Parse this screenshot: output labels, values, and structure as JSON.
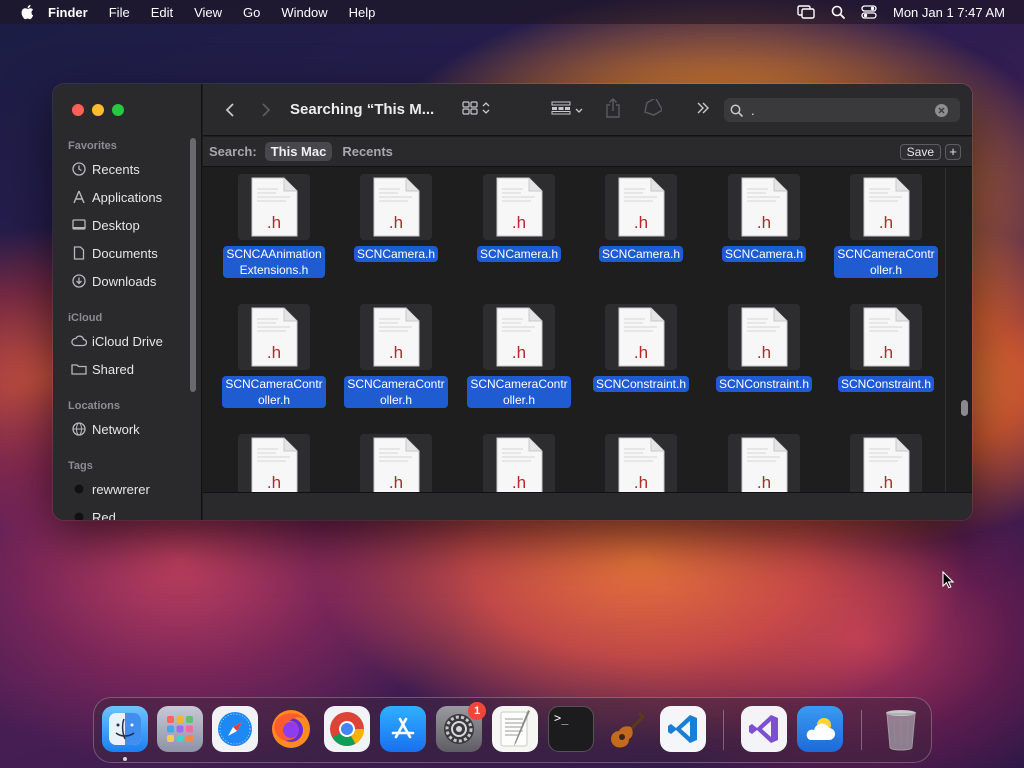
{
  "menubar": {
    "app_name": "Finder",
    "menus": [
      "File",
      "Edit",
      "View",
      "Go",
      "Window",
      "Help"
    ],
    "clock": "Mon Jan 1  7:47 AM"
  },
  "window": {
    "title": "Searching “This M...",
    "search": {
      "value": "."
    },
    "scope": {
      "label": "Search:",
      "options": [
        "This Mac",
        "Recents"
      ],
      "active": "This Mac",
      "save_label": "Save",
      "add_label": "+"
    }
  },
  "sidebar": {
    "favorites_label": "Favorites",
    "favorites": [
      "Recents",
      "Applications",
      "Desktop",
      "Documents",
      "Downloads"
    ],
    "icloud_label": "iCloud",
    "icloud": [
      "iCloud Drive",
      "Shared"
    ],
    "locations_label": "Locations",
    "locations": [
      "Network"
    ],
    "tags_label": "Tags",
    "tags": [
      {
        "label": "rewwrerer",
        "color": "#1c1c1e"
      },
      {
        "label": "Red",
        "color": "#1c1c1e"
      }
    ]
  },
  "files": [
    {
      "name": "SCNCAAnimation Extensions.h",
      "ext": ".h"
    },
    {
      "name": "SCNCamera.h",
      "ext": ".h"
    },
    {
      "name": "SCNCamera.h",
      "ext": ".h"
    },
    {
      "name": "SCNCamera.h",
      "ext": ".h"
    },
    {
      "name": "SCNCamera.h",
      "ext": ".h"
    },
    {
      "name": "SCNCameraContr oller.h",
      "ext": ".h"
    },
    {
      "name": "SCNCameraContr oller.h",
      "ext": ".h"
    },
    {
      "name": "SCNCameraContr oller.h",
      "ext": ".h"
    },
    {
      "name": "SCNCameraContr oller.h",
      "ext": ".h"
    },
    {
      "name": "SCNConstraint.h",
      "ext": ".h"
    },
    {
      "name": "SCNConstraint.h",
      "ext": ".h"
    },
    {
      "name": "SCNConstraint.h",
      "ext": ".h"
    },
    {
      "name": "",
      "ext": ".h"
    },
    {
      "name": "",
      "ext": ".h"
    },
    {
      "name": "",
      "ext": ".h"
    },
    {
      "name": "",
      "ext": ".h"
    },
    {
      "name": "",
      "ext": ".h"
    },
    {
      "name": "",
      "ext": ".h"
    }
  ],
  "dock": {
    "apps": [
      "Finder",
      "Launchpad",
      "Safari",
      "Firefox",
      "Chrome",
      "App Store",
      "System Settings",
      "TextEdit",
      "Terminal",
      "GarageBand",
      "Visual Studio Code",
      "Visual Studio",
      "Weather",
      "Trash"
    ],
    "settings_badge": "1",
    "terminal_prompt": ">_"
  },
  "colors": {
    "selection": "#1f5bd1",
    "file_ext": "#b52a2a"
  }
}
